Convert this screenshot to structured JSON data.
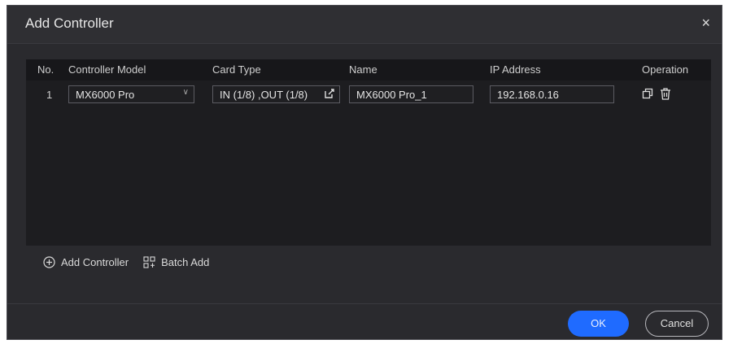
{
  "dialog": {
    "title": "Add Controller",
    "close_label": "×"
  },
  "table": {
    "headers": [
      "No.",
      "Controller Model",
      "Card Type",
      "Name",
      "IP Address",
      "Operation"
    ],
    "rows": [
      {
        "no": "1",
        "controller_model": "MX6000 Pro",
        "card_type": "IN (1/8) ,OUT (1/8)",
        "name": "MX6000 Pro_1",
        "ip_address": "192.168.0.16"
      }
    ]
  },
  "actions": {
    "add_controller": "Add Controller",
    "batch_add": "Batch Add"
  },
  "buttons": {
    "ok": "OK",
    "cancel": "Cancel"
  },
  "colors": {
    "accent": "#1f6bff",
    "background": "#2a2a2e",
    "table_bg": "#1d1d20"
  },
  "icons": [
    "close-icon",
    "chevron-down-icon",
    "edit-icon",
    "copy-icon",
    "trash-icon",
    "plus-circle-icon",
    "batch-add-icon"
  ]
}
